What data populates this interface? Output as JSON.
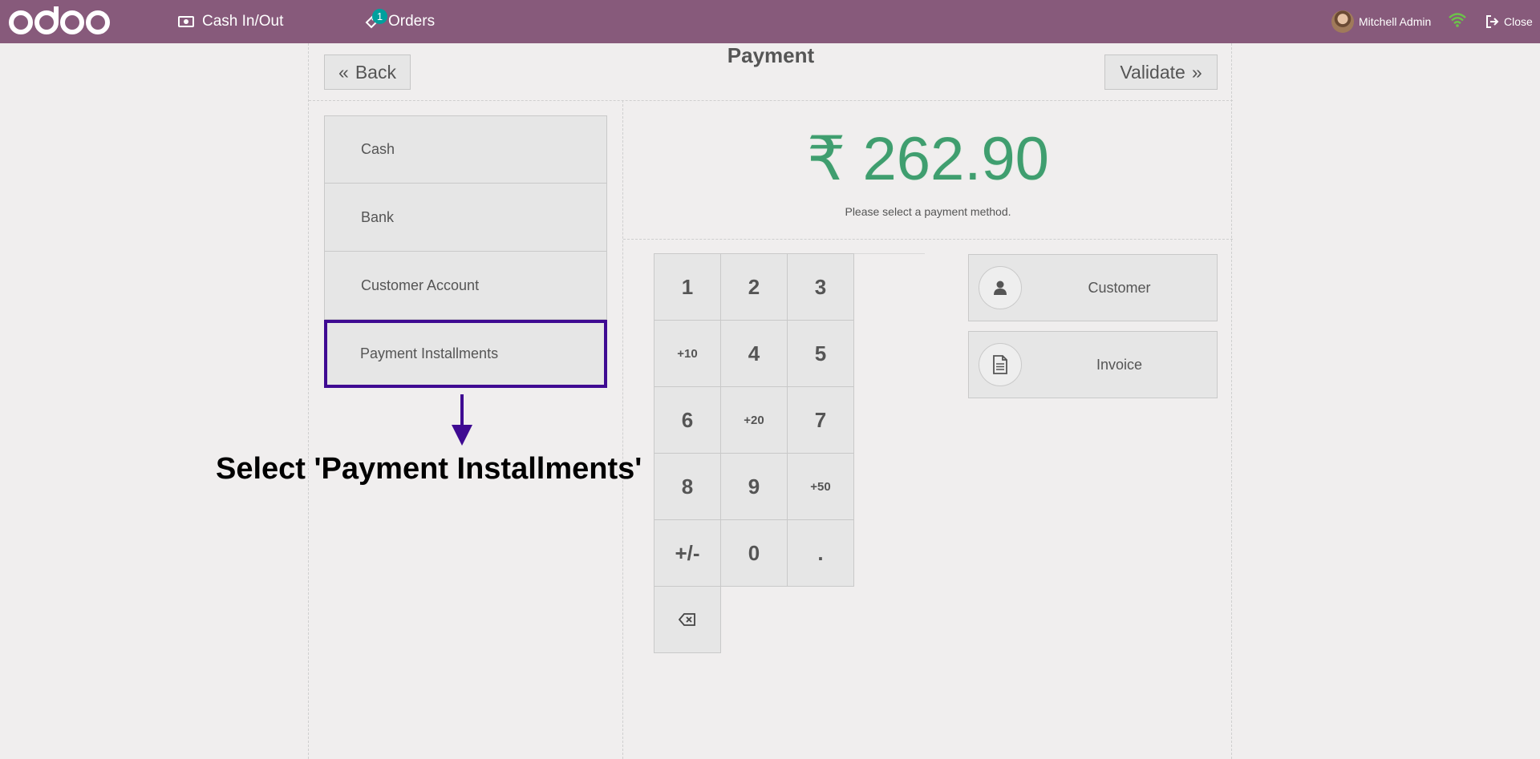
{
  "topbar": {
    "brand": "odoo",
    "cash_inout_label": "Cash In/Out",
    "orders_label": "Orders",
    "orders_badge": "1",
    "user_name": "Mitchell Admin",
    "close_label": "Close"
  },
  "payment": {
    "title": "Payment",
    "back_label": "Back",
    "validate_label": "Validate",
    "amount": "₹ 262.90",
    "status_message": "Please select a payment method."
  },
  "methods": [
    {
      "label": "Cash"
    },
    {
      "label": "Bank"
    },
    {
      "label": "Customer Account"
    },
    {
      "label": "Payment Installments"
    }
  ],
  "numpad": {
    "keys": [
      "1",
      "2",
      "3",
      "+10",
      "4",
      "5",
      "6",
      "+20",
      "7",
      "8",
      "9",
      "+50",
      "+/-",
      "0",
      "."
    ]
  },
  "actions": {
    "customer_label": "Customer",
    "invoice_label": "Invoice"
  },
  "annotation": {
    "callout": "Select 'Payment Installments'",
    "color": "#3f0b92"
  },
  "colors": {
    "topbar": "#875a7b",
    "amount": "#3f9e6f",
    "badge": "#00a09d"
  }
}
